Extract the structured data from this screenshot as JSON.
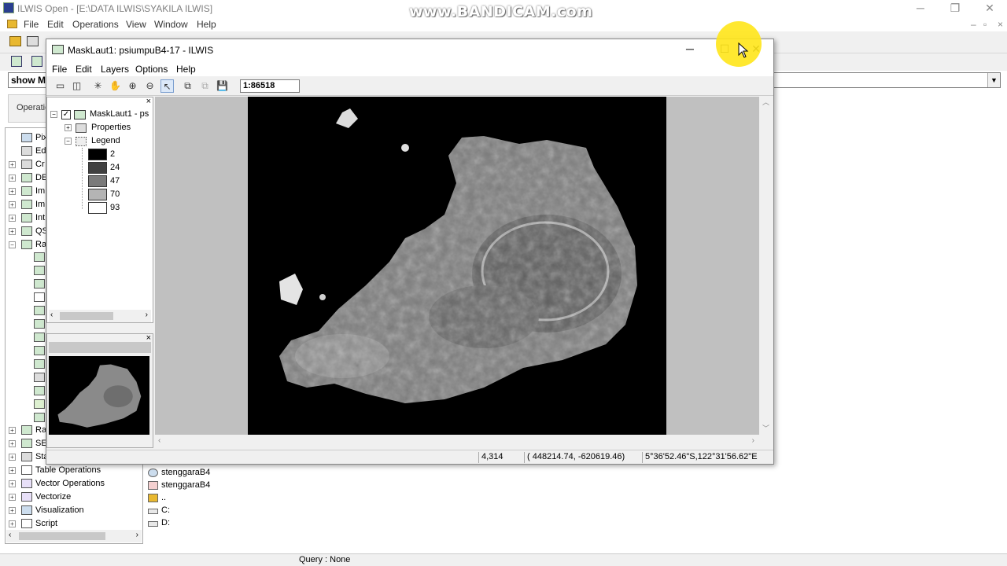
{
  "app": {
    "title": "ILWIS Open - [E:\\DATA ILWIS\\SYAKILA ILWIS]",
    "menu": [
      "File",
      "Edit",
      "Operations",
      "View",
      "Window",
      "Help"
    ],
    "window_controls": [
      "─",
      "❐",
      "✕"
    ],
    "command_line": "show M",
    "operations_tab": "Operatio"
  },
  "operation_tree": [
    {
      "label": "Pix",
      "expand": ""
    },
    {
      "label": "Ed",
      "expand": ""
    },
    {
      "label": "Cr",
      "expand": "+"
    },
    {
      "label": "DE",
      "expand": "+"
    },
    {
      "label": "Im",
      "expand": "+"
    },
    {
      "label": "Im",
      "expand": "+"
    },
    {
      "label": "Int",
      "expand": "+"
    },
    {
      "label": "QS",
      "expand": "+"
    },
    {
      "label": "Ra",
      "expand": "−"
    },
    {
      "label": "Ra",
      "expand": "+"
    },
    {
      "label": "SE",
      "expand": "+"
    },
    {
      "label": "Sta",
      "expand": "+"
    },
    {
      "label": "Table Operations",
      "expand": "+"
    },
    {
      "label": "Vector Operations",
      "expand": "+"
    },
    {
      "label": "Vectorize",
      "expand": "+"
    },
    {
      "label": "Visualization",
      "expand": "+"
    },
    {
      "label": "Script",
      "expand": "+"
    }
  ],
  "catalog": [
    "stenggaraB4",
    "stenggaraB4",
    "..",
    "C:",
    "D:"
  ],
  "status": "Query : None",
  "watermark": "www.BANDICAM.com",
  "map_window": {
    "title": "MaskLaut1: psiumpuB4-17 - ILWIS",
    "menu": [
      "File",
      "Edit",
      "Layers",
      "Options",
      "Help"
    ],
    "scale": "1:86518",
    "layer_name": "MaskLaut1 - ps",
    "properties_label": "Properties",
    "legend_label": "Legend",
    "legend": [
      {
        "label": "2",
        "color": "#000000"
      },
      {
        "label": "24",
        "color": "#404040"
      },
      {
        "label": "47",
        "color": "#7a7a7a"
      },
      {
        "label": "70",
        "color": "#b4b4b4"
      },
      {
        "label": "93",
        "color": "#ffffff"
      }
    ],
    "status": {
      "rowcol": "4,314",
      "coords": "(   448214.74,  -620619.46)",
      "latlon": "5°36'52.46\"S,122°31'56.62\"E"
    },
    "close_x": "×"
  }
}
